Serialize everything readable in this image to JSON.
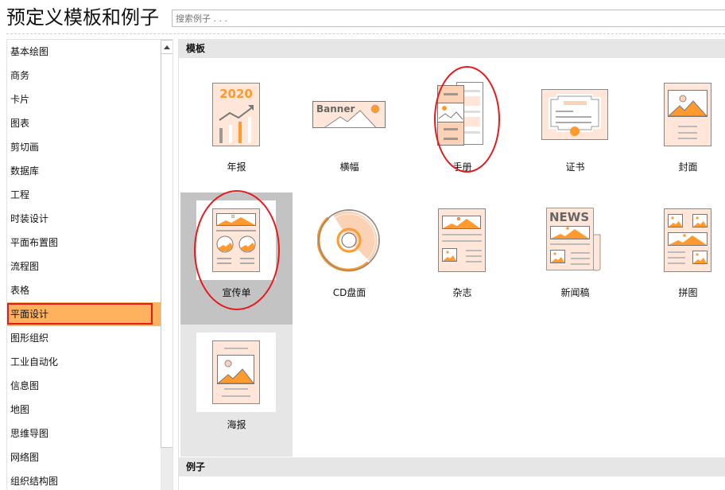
{
  "header": {
    "title": "预定义模板和例子",
    "search_placeholder": "搜索例子 . . ."
  },
  "sidebar": {
    "items": [
      {
        "label": "基本绘图"
      },
      {
        "label": "商务"
      },
      {
        "label": "卡片"
      },
      {
        "label": "图表"
      },
      {
        "label": "剪切画"
      },
      {
        "label": "数据库"
      },
      {
        "label": "工程"
      },
      {
        "label": "时装设计"
      },
      {
        "label": "平面布置图"
      },
      {
        "label": "流程图"
      },
      {
        "label": "表格"
      },
      {
        "label": "平面设计",
        "active": true
      },
      {
        "label": "图形组织"
      },
      {
        "label": "工业自动化"
      },
      {
        "label": "信息图"
      },
      {
        "label": "地图"
      },
      {
        "label": "思维导图"
      },
      {
        "label": "网络图"
      },
      {
        "label": "组织结构图"
      }
    ]
  },
  "main": {
    "templates_heading": "模板",
    "examples_heading": "例子",
    "templates": [
      {
        "label": "年报",
        "icon": "annual-report-icon",
        "year_text": "2020"
      },
      {
        "label": "横幅",
        "icon": "banner-icon",
        "banner_text": "Banner"
      },
      {
        "label": "手册",
        "icon": "brochure-icon",
        "annotated": true
      },
      {
        "label": "证书",
        "icon": "certificate-icon"
      },
      {
        "label": "封面",
        "icon": "cover-icon"
      },
      {
        "label": "宣传单",
        "icon": "flyer-icon",
        "selected": true,
        "annotated": true
      },
      {
        "label": "CD盘面",
        "icon": "cd-icon"
      },
      {
        "label": "杂志",
        "icon": "magazine-icon"
      },
      {
        "label": "新闻稿",
        "icon": "newsletter-icon",
        "news_text": "NEWS"
      },
      {
        "label": "拼图",
        "icon": "collage-icon"
      },
      {
        "label": "海报",
        "icon": "poster-icon",
        "hover": true
      }
    ]
  },
  "colors": {
    "accent_orange": "#ff9a2e",
    "light_peach": "#ffe6d8",
    "selected_sidebar": "#ffb25d",
    "annotation_red": "#e8191d",
    "selected_tile": "#c3c3c3",
    "section_header": "#e6e6e6"
  }
}
